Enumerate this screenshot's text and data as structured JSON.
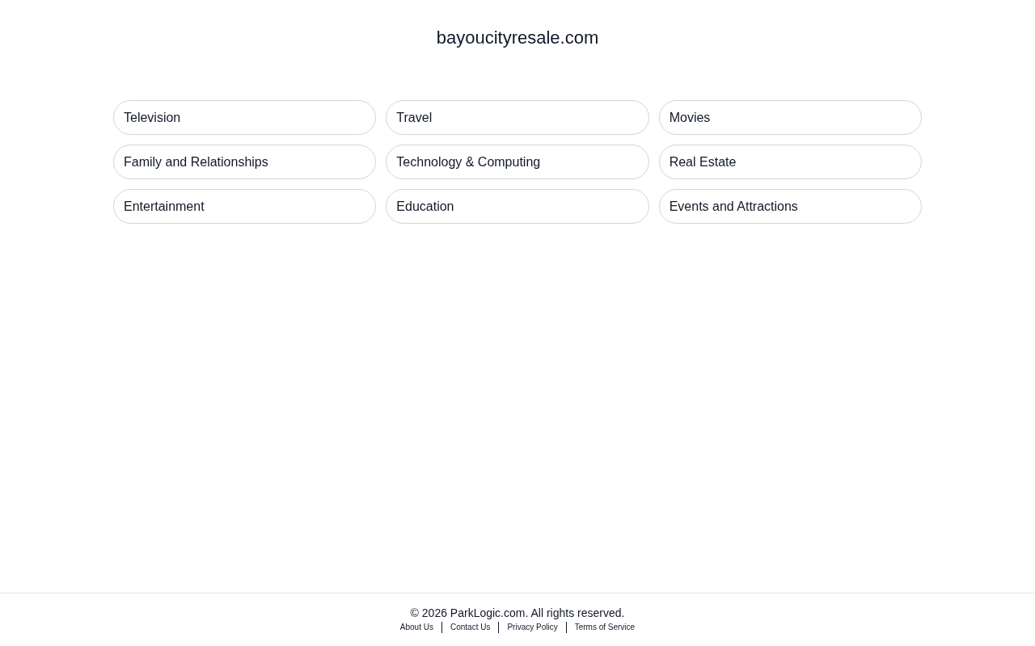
{
  "site_title": "bayoucityresale.com",
  "links": [
    "Television",
    "Travel",
    "Movies",
    "Family and Relationships",
    "Technology & Computing",
    "Real Estate",
    "Entertainment",
    "Education",
    "Events and Attractions"
  ],
  "footer": {
    "copyright": "© 2026 ParkLogic.com. All rights reserved.",
    "links": [
      "About Us",
      "Contact Us",
      "Privacy Policy",
      "Terms of Service"
    ]
  }
}
